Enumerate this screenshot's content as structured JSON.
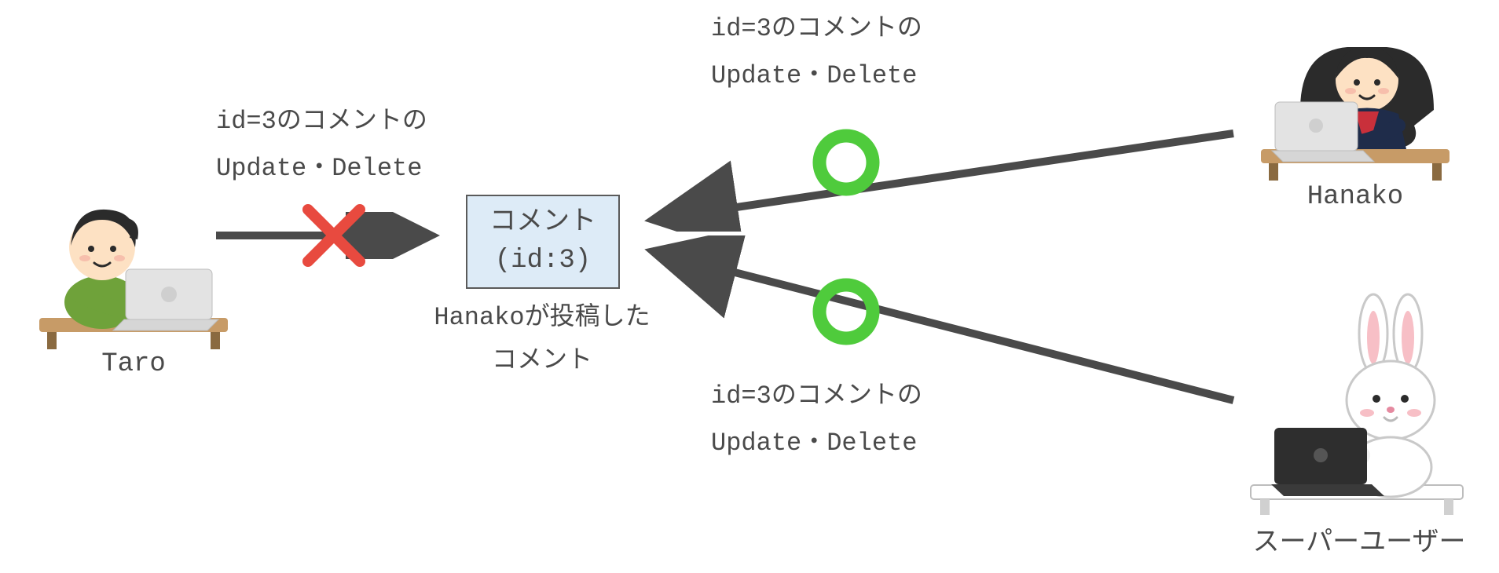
{
  "actors": {
    "taro": {
      "name": "Taro",
      "action_l1": "id=3のコメントの",
      "action_l2": "Update・Delete"
    },
    "hanako": {
      "name": "Hanako",
      "action_l1": "id=3のコメントの",
      "action_l2": "Update・Delete"
    },
    "superuser": {
      "name": "スーパーユーザー",
      "action_l1": "id=3のコメントの",
      "action_l2": "Update・Delete"
    }
  },
  "comment": {
    "title": "コメント",
    "id_label": "(id:3)",
    "caption_l1": "Hanakoが投稿した",
    "caption_l2": "コメント"
  },
  "marks": {
    "taro": "deny",
    "hanako": "allow",
    "superuser": "allow"
  },
  "colors": {
    "allow": "#4FCB3C",
    "deny": "#E84A3F",
    "arrow": "#4a4a4a",
    "box_bg": "#DDEBF7",
    "box_border": "#5a5a5a",
    "desk": "#C79B67"
  }
}
